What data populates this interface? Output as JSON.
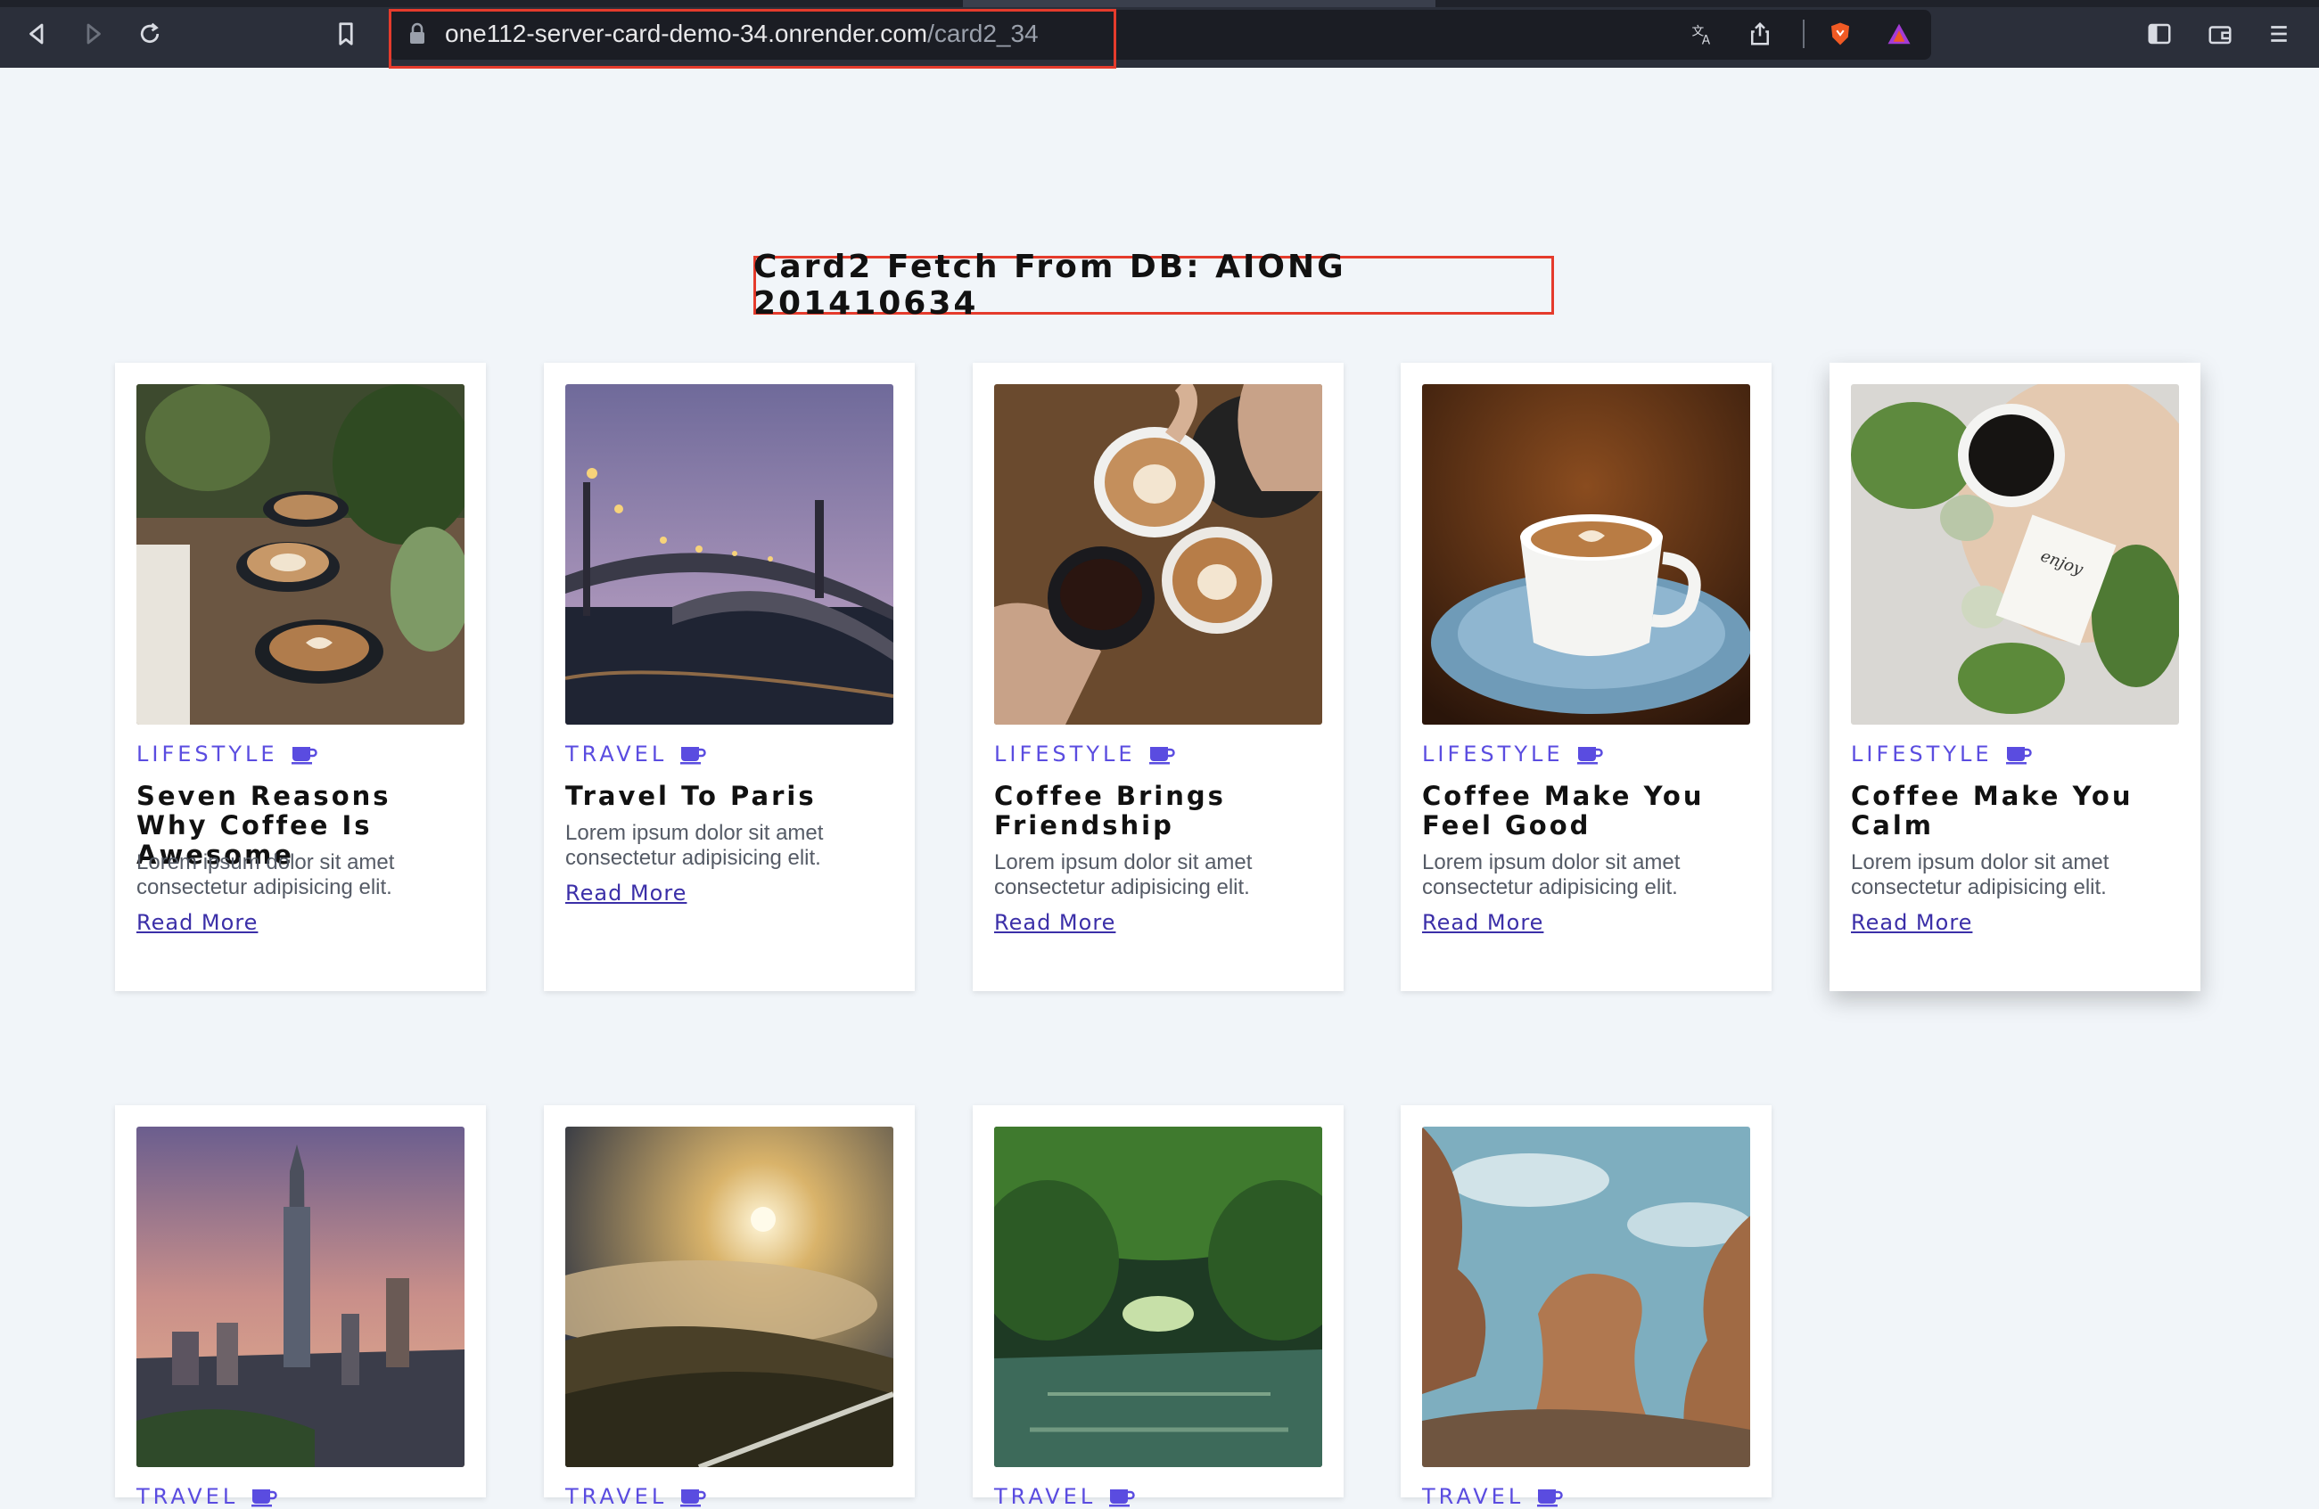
{
  "browser": {
    "url_host": "one112-server-card-demo-34.onrender.com",
    "url_path": "/card2_34",
    "icons": [
      "back-icon",
      "forward-icon",
      "reload-icon",
      "bookmark-icon",
      "lock-icon",
      "translate-icon",
      "share-icon",
      "brave-shield-icon",
      "brave-rewards-icon",
      "sidebar-icon",
      "wallet-icon",
      "menu-icon"
    ]
  },
  "page": {
    "heading": "Card2 Fetch From DB: AIONG 201410634"
  },
  "cards": [
    {
      "category": "LIFESTYLE",
      "title": "Seven Reasons Why Coffee Is Awesome",
      "desc": "Lorem ipsum dolor sit amet consectetur adipisicing elit.",
      "link": "Read More",
      "image": "coffee-cups-latte-art"
    },
    {
      "category": "TRAVEL",
      "title": "Travel To Paris",
      "desc": "Lorem ipsum dolor sit amet consectetur adipisicing elit.",
      "link": "Read More",
      "image": "paris-bridge-dusk"
    },
    {
      "category": "LIFESTYLE",
      "title": "Coffee Brings Friendship",
      "desc": "Lorem ipsum dolor sit amet consectetur adipisicing elit.",
      "link": "Read More",
      "image": "hands-toasting-coffee"
    },
    {
      "category": "LIFESTYLE",
      "title": "Coffee Make You Feel Good",
      "desc": "Lorem ipsum dolor sit amet consectetur adipisicing elit.",
      "link": "Read More",
      "image": "coffee-cup-saucer"
    },
    {
      "category": "LIFESTYLE",
      "title": "Coffee Make You Calm",
      "desc": "Lorem ipsum dolor sit amet consectetur adipisicing elit.",
      "link": "Read More",
      "image": "coffee-leaves-note"
    },
    {
      "category": "TRAVEL",
      "image": "taipei-101-skyline"
    },
    {
      "category": "TRAVEL",
      "image": "sunrise-over-clouds"
    },
    {
      "category": "TRAVEL",
      "image": "tree-tunnel-river"
    },
    {
      "category": "TRAVEL",
      "image": "rock-formation-coast"
    }
  ],
  "colors": {
    "accent": "#5a4ce0",
    "link": "#3b2fa8",
    "highlight": "#e53b2c",
    "background": "#f1f5f9"
  }
}
